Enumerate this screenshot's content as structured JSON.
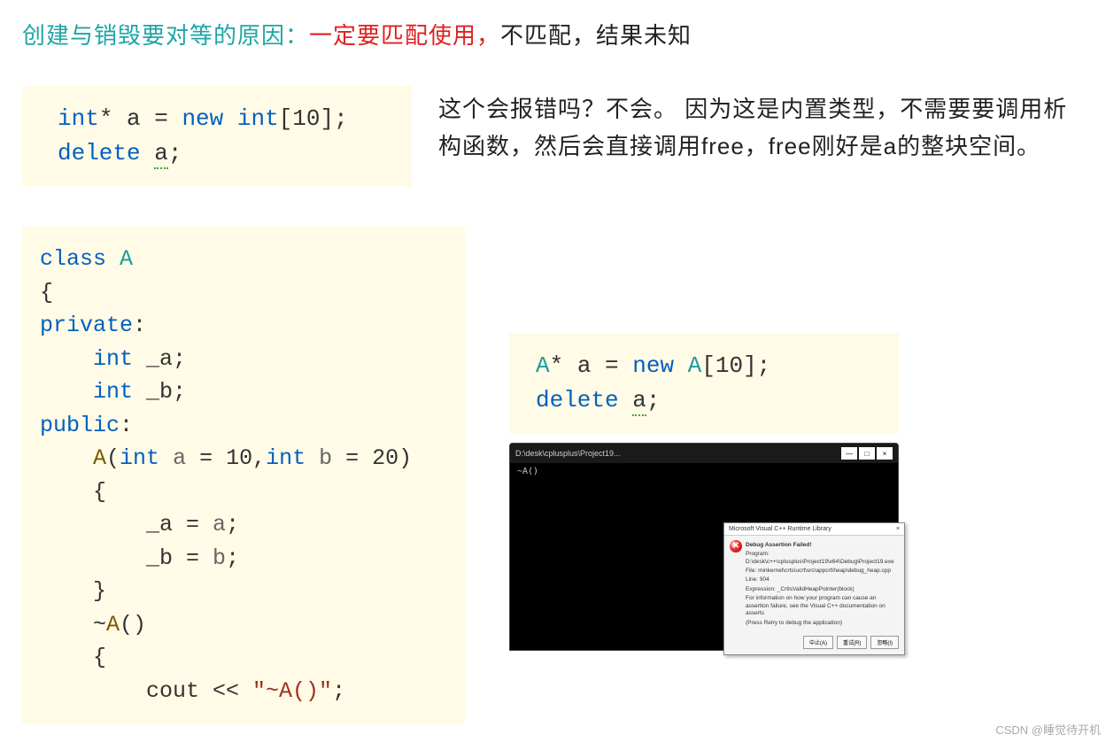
{
  "header": {
    "label": "创建与销毁要对等的原因：",
    "warning": "一定要匹配使用，",
    "tail": "不匹配，结果未知"
  },
  "snippet1": {
    "code_html": "<span class='type'>int</span>* a = <span class='kw'>new</span> <span class='type'>int</span>[10];\n<span class='kw'>delete</span> <span class='squiggle'>a</span>;"
  },
  "explanation1": "这个会报错吗？不会。 因为这是内置类型，不需要要调用析构函数，然后会直接调用free，free刚好是a的整块空间。",
  "class_code": {
    "code_html": "<span class='kw'>class</span> <span class='cls'>A</span>\n{\n<span class='kw'>private</span>:\n    <span class='type'>int</span> _a;\n    <span class='type'>int</span> _b;\n<span class='kw'>public</span>:\n    <span class='fn'>A</span>(<span class='type'>int</span> <span class='var'>a</span> = 10,<span class='type'>int</span> <span class='var'>b</span> = 20)\n    {\n        _a = <span class='var'>a</span>;\n        _b = <span class='var'>b</span>;\n    }\n    ~<span class='fn'>A</span>()\n    {\n        cout &lt;&lt; <span class='str'>\"~A()\"</span>;"
  },
  "snippet2": {
    "code_html": "<span class='cls'>A</span>* a = <span class='kw'>new</span> <span class='cls'>A</span>[10];\n<span class='kw'>delete</span> <span class='squiggle'>a</span>;"
  },
  "debugger": {
    "path": "D:\\desk\\cplusplus\\Project19...",
    "console": "~A()"
  },
  "dialog": {
    "title": "Microsoft Visual C++ Runtime Library",
    "heading": "Debug Assertion Failed!",
    "program": "Program: D:\\desk\\c++\\cplusplus\\Project19\\x64\\Debug\\Project19.exe",
    "file": "File: minkernel\\crts\\ucrt\\src\\appcrt\\heap\\debug_heap.cpp",
    "line_label": "Line: 904",
    "expr": "Expression: _CrtIsValidHeapPointer(block)",
    "info": "For information on how your program can cause an assertion failure, see the Visual C++ documentation on asserts",
    "retry": "(Press Retry to debug the application)",
    "btn_abort": "中止(A)",
    "btn_retry": "重试(R)",
    "btn_ignore": "忽略(I)"
  },
  "watermark": "CSDN @睡觉待开机"
}
